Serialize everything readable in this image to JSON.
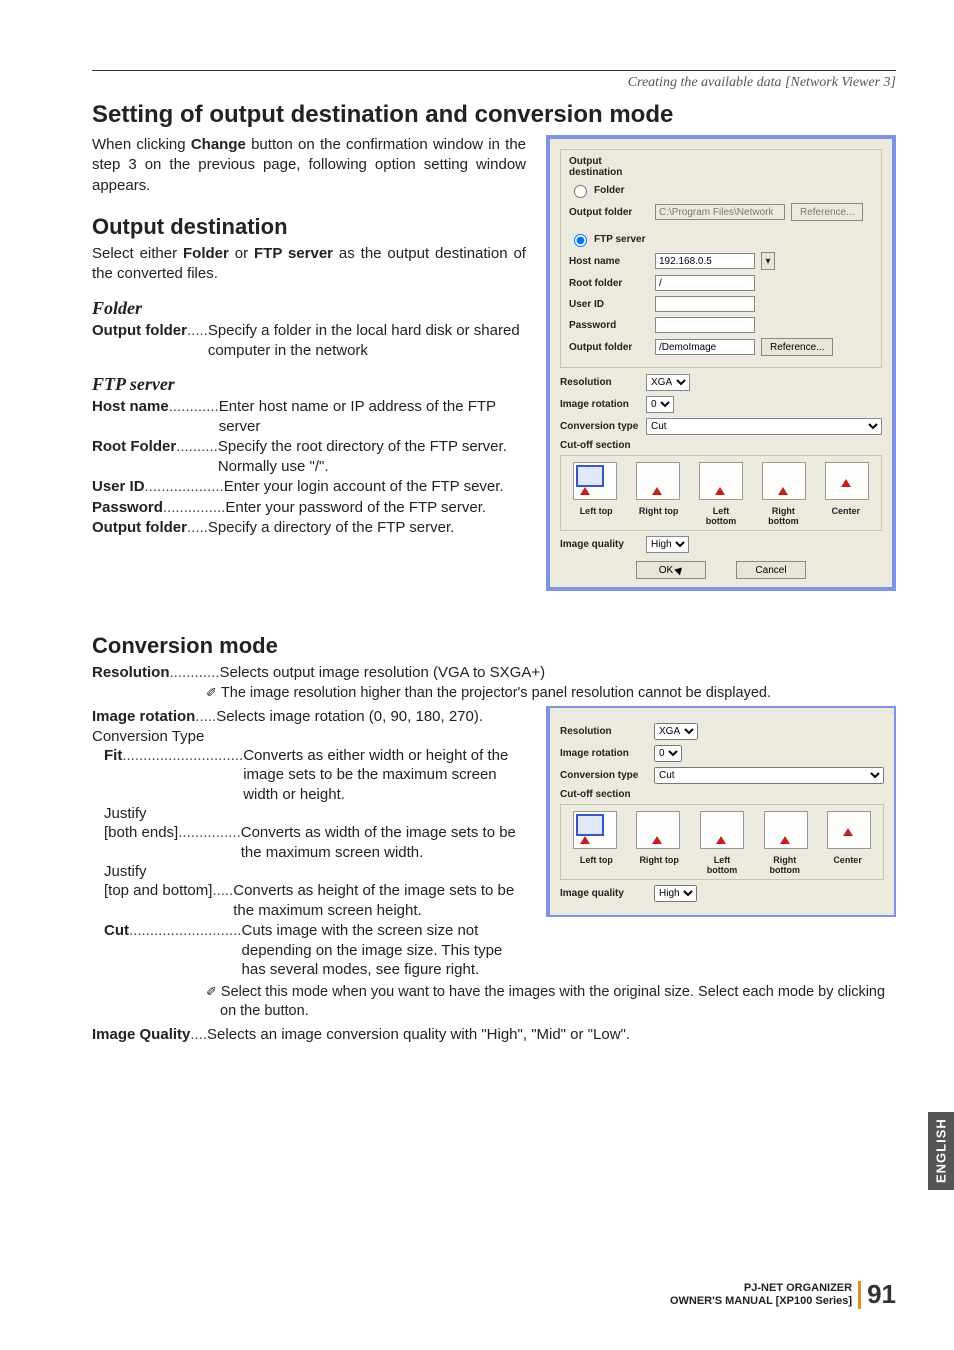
{
  "chapter": "Creating the available data [Network Viewer 3]",
  "h_output_conv": "Setting of output destination and conversion mode",
  "p_output_conv": "When clicking Change button on the confirmation window in the step 3 on the previous page, following option setting window appears.",
  "p_output_conv_parts": {
    "pre": "When clicking ",
    "bold": "Change",
    "post": " button on the confirmation window in the step 3 on the previous page, following option setting window appears."
  },
  "h_output_dest": "Output destination",
  "p_output_dest_parts": {
    "a": "Select either ",
    "b1": "Folder",
    "b": " or ",
    "b2": "FTP server",
    "c": " as the output destination of the converted files."
  },
  "folder": {
    "title": "Folder",
    "output_folder_term": "Output folder",
    "output_folder_desc": "Specify a folder in the local hard disk or shared computer in the network"
  },
  "ftp": {
    "title": "FTP server",
    "host_term": "Host name",
    "host_desc": "Enter host name or IP address of the FTP server",
    "root_term": "Root Folder",
    "root_desc": "Specify the root directory of the FTP server. Normally use \"/\".",
    "user_term": "User ID",
    "user_desc": "Enter your login account of the FTP sever.",
    "pass_term": "Password",
    "pass_desc": "Enter your password of the FTP server.",
    "out_term": "Output folder",
    "out_desc": "Specify a directory of the FTP server."
  },
  "h_conv": "Conversion mode",
  "conv": {
    "res_term": "Resolution",
    "res_desc": "Selects output image resolution (VGA to SXGA+)",
    "res_note": "The image resolution higher than the projector's panel resolution cannot be displayed.",
    "rot_term": "Image rotation",
    "rot_desc": "Selects image rotation (0, 90, 180, 270).",
    "type_label": "Conversion Type",
    "fit_term": "Fit",
    "fit_desc": "Converts as either width or height of the image  sets to be the maximum screen width or height.",
    "justify1_label": "Justify",
    "justify1_term": "[both ends]",
    "justify1_desc": "Converts as width of the image sets to be the maximum screen width.",
    "justify2_label": "Justify",
    "justify2_term": "[top and bottom]",
    "justify2_desc": "Converts as height of the image sets to be the maximum screen height.",
    "cut_term": "Cut",
    "cut_desc": "Cuts image with the screen size not depending on the image size. This type has several modes, see figure right.",
    "cut_note": "Select this mode when you want to have the images with the original size. Select each mode by clicking on the button.",
    "iq_term": "Image Quality",
    "iq_desc": "Selects an image conversion quality with \"High\", \"Mid\" or \"Low\"."
  },
  "dialog": {
    "output_dest": "Output destination",
    "folder_radio": "Folder",
    "output_folder_lbl": "Output folder",
    "output_folder_val": "C:\\Program Files\\Network",
    "reference": "Reference...",
    "ftp_radio": "FTP server",
    "host_lbl": "Host name",
    "host_val": "192.168.0.5",
    "root_lbl": "Root folder",
    "root_val": "/",
    "user_lbl": "User ID",
    "user_val": "",
    "pass_lbl": "Password",
    "pass_val": "",
    "out2_lbl": "Output folder",
    "out2_val": "/DemoImage",
    "res_lbl": "Resolution",
    "res_val": "XGA",
    "rot_lbl": "Image rotation",
    "rot_val": "0",
    "ctype_lbl": "Conversion type",
    "ctype_val": "Cut",
    "cutoff_lbl": "Cut-off section",
    "cut_labels": [
      "Left top",
      "Right top",
      "Left bottom",
      "Right bottom",
      "Center"
    ],
    "iq_lbl": "Image quality",
    "iq_val": "High",
    "ok": "OK",
    "cancel": "Cancel"
  },
  "sidebar": "ENGLISH",
  "footer": {
    "product": "PJ-NET ORGANIZER",
    "manual": "OWNER'S MANUAL [XP100 Series]",
    "page": "91"
  }
}
